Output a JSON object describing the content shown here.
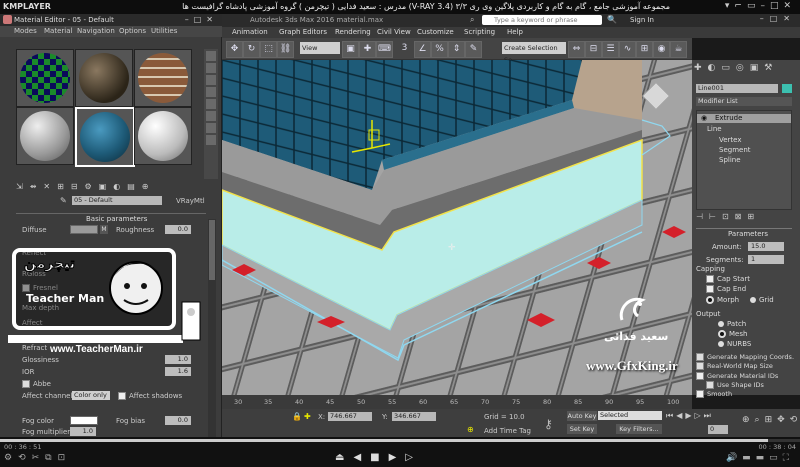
{
  "player": {
    "logo": "KMPLAYER",
    "title": "مجموعه آموزشی جامع ، گام به گام و کاربردی پلاگین وی ری ۳/۳ (V-RAY 3.4) مدرس : سعید فدایی ( تیچرمن ) گروه آموزشی پادشاه گرافیست ها",
    "time_current": "00 : 36 : 51",
    "time_total": "00 : 38 : 04",
    "progress_fraction": 0.96
  },
  "max": {
    "app_title": "Autodesk 3ds Max 2016   material.max",
    "search_placeholder": "Type a keyword or phrase",
    "signin": "Sign In",
    "menus": [
      "Animation",
      "Graph Editors",
      "Rendering",
      "Civil View",
      "Customize",
      "Scripting",
      "Help"
    ],
    "toolbar": {
      "view_select": "View",
      "selection_set": "Create Selection Se",
      "snap_count": "3"
    }
  },
  "mat_editor": {
    "title": "Material Editor - 05 - Default",
    "menus": [
      "Modes",
      "Material",
      "Navigation",
      "Options",
      "Utilities"
    ],
    "material_name": "05 - Default",
    "material_type": "VRayMtl",
    "rollout_title": "Basic parameters",
    "rows": {
      "diffuse": "Diffuse",
      "diffuse_map": "M",
      "roughness": "Roughness",
      "roughness_val": "0.0",
      "reflect": "Reflect",
      "rgloss": "RGloss",
      "fresnel": "Fresnel",
      "max_depth": "Max depth",
      "affect": "Affect",
      "refract": "Refract",
      "glossiness": "Glossiness",
      "glossiness_val": "1.0",
      "ior": "IOR",
      "ior_val": "1.6",
      "abbe": "Abbe",
      "affect_channels": "Affect channels",
      "affect_channels_val": "Color only",
      "affect_shadows": "Affect shadows",
      "fog_color": "Fog color",
      "fog_bias": "Fog bias",
      "fog_bias_val": "0.0",
      "fog_multiplier": "Fog multiplier",
      "fog_multiplier_val": "1.0"
    }
  },
  "watermark": {
    "brand_top": "تیچرمن",
    "brand": "Teacher Man",
    "url": "www.TeacherMan.ir",
    "author": "سعید فدائی",
    "site": "www.GfxKing.ir"
  },
  "command_panel": {
    "object_name": "Line001",
    "modifier_list": "Modifier List",
    "stack": [
      "Extrude",
      "Line",
      "Vertex",
      "Segment",
      "Spline"
    ],
    "parameters_title": "Parameters",
    "amount_label": "Amount:",
    "amount": "15.0",
    "segments_label": "Segments:",
    "segments": "1",
    "capping": "Capping",
    "cap_start": "Cap Start",
    "cap_end": "Cap End",
    "morph": "Morph",
    "grid": "Grid",
    "output": "Output",
    "patch": "Patch",
    "mesh": "Mesh",
    "nurbs": "NURBS",
    "gen_mapping": "Generate Mapping Coords.",
    "real_world": "Real-World Map Size",
    "gen_matids": "Generate Material IDs",
    "use_shapeids": "Use Shape IDs",
    "smooth": "Smooth"
  },
  "timeline": {
    "ticks": [
      "30",
      "35",
      "40",
      "45",
      "50",
      "55",
      "60",
      "65",
      "70",
      "75",
      "80",
      "85",
      "90",
      "95",
      "100"
    ]
  },
  "status": {
    "x_label": "X:",
    "x_val": "746.667",
    "y_label": "Y:",
    "y_val": "346.667",
    "grid": "Grid = 10.0",
    "add_time_tag": "Add Time Tag",
    "auto_key": "Auto Key",
    "selected": "Selected",
    "set_key": "Set Key",
    "key_filters": "Key Filters...",
    "frame": "0"
  },
  "colors": {
    "tile_blue": "#1e5b78",
    "border_yellow": "#f2e24a",
    "border_cyan": "#8fd8f0",
    "accent_red": "#d4202a"
  }
}
